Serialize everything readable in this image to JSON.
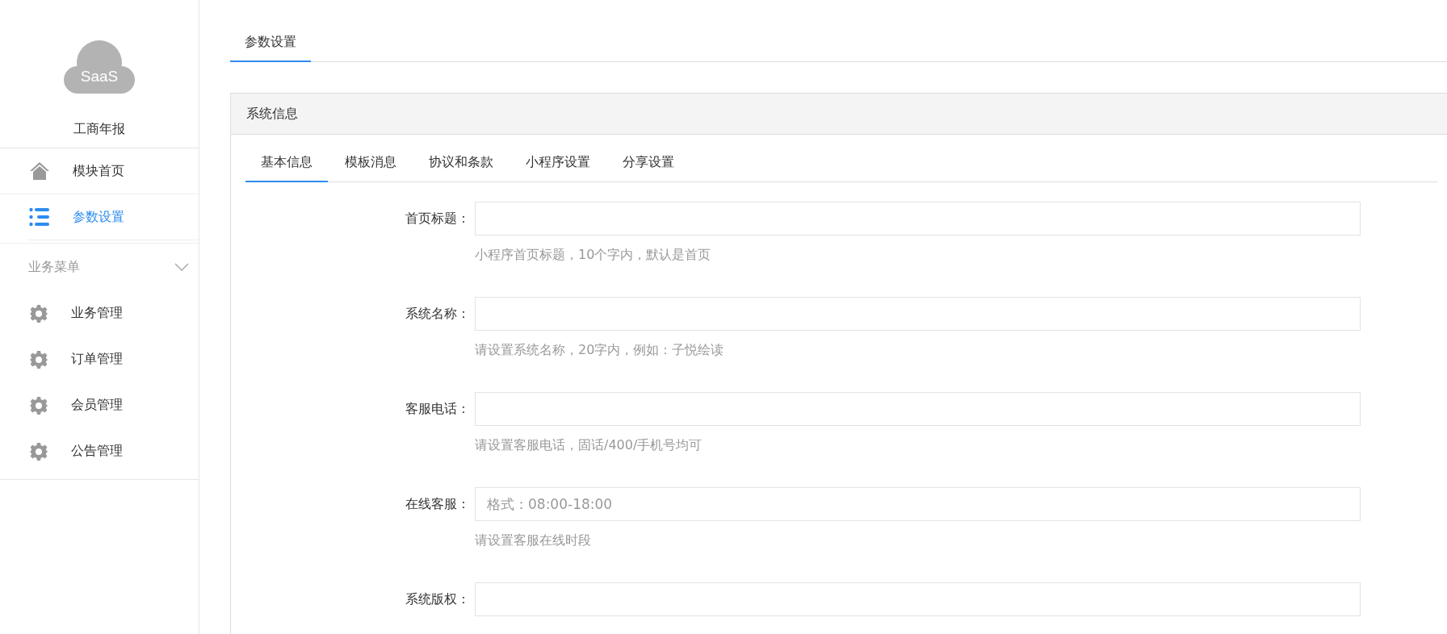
{
  "sidebar": {
    "logo": {
      "text": "SaaS"
    },
    "app_name": "工商年报",
    "items": [
      {
        "label": "模块首页",
        "kind": "home",
        "selected": false
      },
      {
        "label": "参数设置",
        "kind": "list",
        "selected": true
      }
    ],
    "group": {
      "label": "业务菜单",
      "expanded": true,
      "items": [
        {
          "label": "业务管理",
          "kind": "gear",
          "selected": false
        },
        {
          "label": "订单管理",
          "kind": "gear",
          "selected": false
        },
        {
          "label": "会员管理",
          "kind": "gear",
          "selected": false
        },
        {
          "label": "公告管理",
          "kind": "gear",
          "selected": false
        }
      ]
    }
  },
  "page_tabs": [
    {
      "label": "参数设置",
      "selected": true
    }
  ],
  "panel": {
    "title": "系统信息",
    "tabs": [
      {
        "label": "基本信息",
        "selected": true
      },
      {
        "label": "模板消息",
        "selected": false
      },
      {
        "label": "协议和条款",
        "selected": false
      },
      {
        "label": "小程序设置",
        "selected": false
      },
      {
        "label": "分享设置",
        "selected": false
      }
    ],
    "fields": [
      {
        "label": "首页标题：",
        "hint": "小程序首页标题，10个字内，默认是首页"
      },
      {
        "label": "系统名称：",
        "hint": "请设置系统名称，20字内，例如：子悦绘读"
      },
      {
        "label": "客服电话：",
        "hint": "请设置客服电话，固话/400/手机号均可"
      },
      {
        "label": "在线客服：",
        "placeholder": "格式：08:00-18:00",
        "hint": "请设置客服在线时段"
      },
      {
        "label": "系统版权："
      }
    ]
  }
}
